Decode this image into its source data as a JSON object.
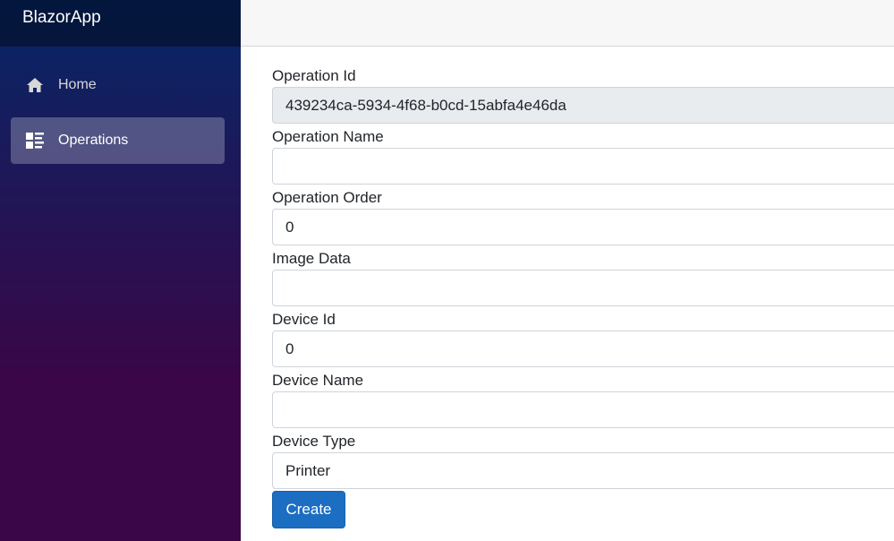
{
  "app": {
    "brand": "BlazorApp"
  },
  "nav": {
    "items": [
      {
        "label": "Home",
        "icon": "home-icon",
        "active": false
      },
      {
        "label": "Operations",
        "icon": "list-icon",
        "active": true
      }
    ]
  },
  "form": {
    "fields": [
      {
        "label": "Operation Id",
        "value": "439234ca-5934-4f68-b0cd-15abfa4e46da",
        "readonly": true
      },
      {
        "label": "Operation Name",
        "value": ""
      },
      {
        "label": "Operation Order",
        "value": "0"
      },
      {
        "label": "Image Data",
        "value": ""
      },
      {
        "label": "Device Id",
        "value": "0"
      },
      {
        "label": "Device Name",
        "value": ""
      },
      {
        "label": "Device Type",
        "value": "Printer"
      }
    ],
    "submit_label": "Create"
  },
  "colors": {
    "sidebar_top": "#052767",
    "sidebar_bottom": "#3a0647",
    "primary_button": "#1b6ec2"
  }
}
